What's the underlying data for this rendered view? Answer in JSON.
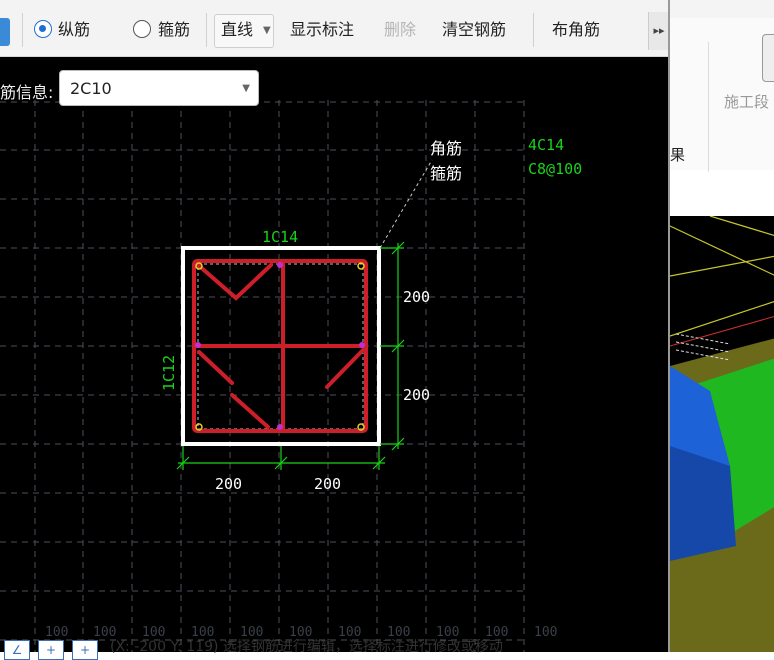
{
  "toolbar": {
    "radio_longitudinal": "纵筋",
    "radio_stirrup": "箍筋",
    "line_mode": "直线",
    "show_annotation": "显示标注",
    "delete": "删除",
    "clear_rebar": "清空钢筋",
    "place_corner_rebar": "布角筋",
    "more": "▸▸"
  },
  "rebar_info": {
    "label": "筋信息:",
    "value": "2C10"
  },
  "drawing": {
    "legend_corner_label": "角筋",
    "legend_corner_value": "4C14",
    "legend_stirrup_label": "箍筋",
    "legend_stirrup_value": "C8@100",
    "top_rebar": "1C14",
    "side_rebar": "1C12",
    "dim_right_top": "200",
    "dim_right_bottom": "200",
    "dim_bottom_left": "200",
    "dim_bottom_right": "200",
    "grid_bottom_numbers": [
      "100",
      "100",
      "100",
      "100",
      "100",
      "100",
      "100",
      "100",
      "100",
      "100",
      "100"
    ]
  },
  "right_panel": {
    "ribbon_label": "施工段",
    "side_label": "果"
  },
  "status": {
    "btn1": "∠",
    "btn2": "+",
    "btn3": "+",
    "text": "(X: -200 Y: 119) 选择钢筋进行编辑，选择标注进行修改或移动"
  },
  "colors": {
    "canvas_bg": "#000000",
    "rebar_red": "#cc1f2a",
    "dimension_green": "#19d219",
    "section_white": "#ffffff",
    "grid_gray": "#4a4f5a"
  }
}
